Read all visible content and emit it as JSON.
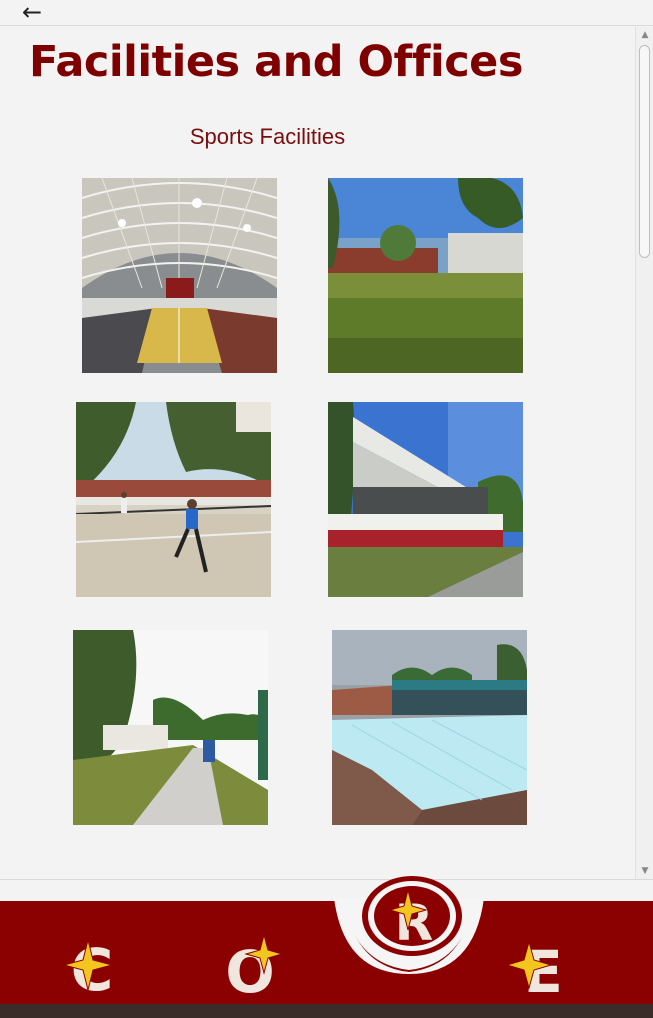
{
  "header": {
    "back_icon": "←"
  },
  "page": {
    "title": "Facilities and Offices",
    "section_title": "Sports Facilities"
  },
  "gallery": {
    "images": [
      {
        "name": "indoor-gymnasium-photo"
      },
      {
        "name": "open-field-photo"
      },
      {
        "name": "tennis-court-photo"
      },
      {
        "name": "grandstand-photo"
      },
      {
        "name": "track-oval-photo"
      },
      {
        "name": "swimming-pool-photo"
      }
    ]
  },
  "bottom_nav": {
    "items": [
      {
        "letter": "C"
      },
      {
        "letter": "O"
      },
      {
        "letter": "R"
      },
      {
        "letter": "E"
      }
    ],
    "colors": {
      "background": "#8b0000",
      "letter": "#f1e6dd",
      "star": "#f2c61f"
    }
  },
  "theme": {
    "title_color": "#7f0000",
    "accent": "#8b0000"
  }
}
